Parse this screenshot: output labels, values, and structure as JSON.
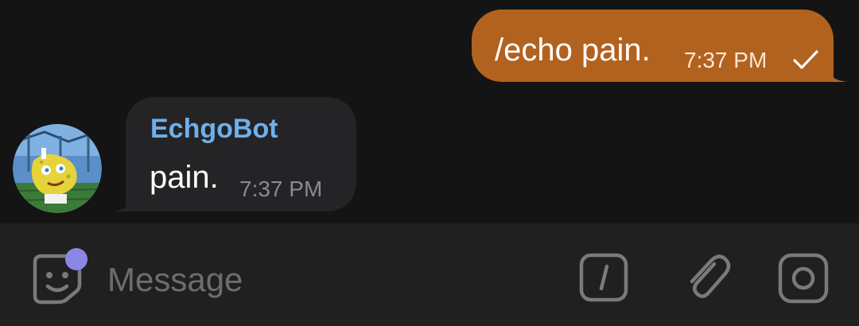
{
  "chat": {
    "outgoing": {
      "text": "/echo pain.",
      "time": "7:37 PM",
      "status_icon": "check-icon"
    },
    "incoming": {
      "sender": "EchgoBot",
      "text": "pain.",
      "time": "7:37 PM",
      "avatar_icon": "bot-avatar"
    }
  },
  "composer": {
    "placeholder": "Message",
    "value": "",
    "icons": [
      "sticker-icon",
      "bot-command-icon",
      "paperclip-icon",
      "camera-icon"
    ]
  },
  "colors": {
    "background": "#141414",
    "outgoing_bubble": "#b2621f",
    "incoming_bubble": "#242426",
    "sender_name": "#6fb0ea",
    "composer_bg": "#202020",
    "notify_dot": "#8a87e6"
  }
}
